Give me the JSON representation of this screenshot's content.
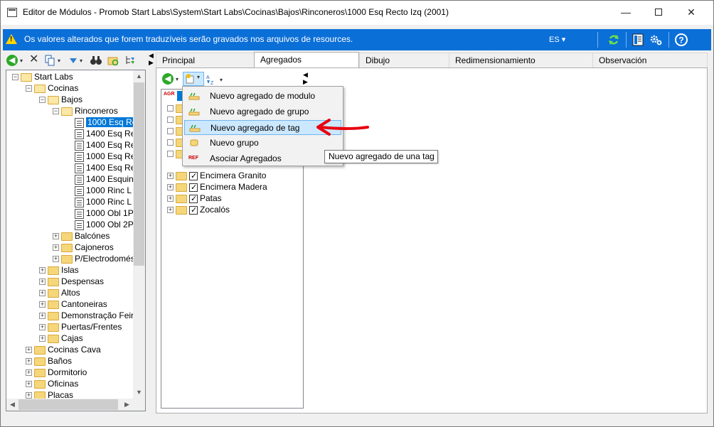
{
  "window": {
    "title": "Editor de Módulos - Promob Start Labs\\System\\Start Labs\\Cocinas\\Bajos\\Rinconeros\\1000 Esq Recto Izq (2001)",
    "minimize_label": "—",
    "close_label": "✕"
  },
  "infobar": {
    "message": "Os valores alterados que forem traduzíveis serão gravados nos arquivos de resources.",
    "warning_glyph": "!",
    "language": "ES ▾",
    "bg_color": "#0b6fd8"
  },
  "left_toolbar": {
    "back_glyph": "◀",
    "delete_glyph": "✕",
    "arrow_glyph": "▾"
  },
  "tree": {
    "items": [
      {
        "label": "Start Labs",
        "level": 0,
        "icon": "folder-open-icon",
        "exp": "−"
      },
      {
        "label": "Cocinas",
        "level": 1,
        "icon": "folder-open-icon",
        "exp": "−"
      },
      {
        "label": "Bajos",
        "level": 2,
        "icon": "folder-open-icon",
        "exp": "−"
      },
      {
        "label": "Rinconeros",
        "level": 3,
        "icon": "folder-open-icon",
        "exp": "−"
      },
      {
        "label": "1000 Esq Re",
        "level": 4,
        "icon": "doc-icon",
        "selected": true
      },
      {
        "label": "1400 Esq Re",
        "level": 4,
        "icon": "doc-icon"
      },
      {
        "label": "1400 Esq Re",
        "level": 4,
        "icon": "doc-icon"
      },
      {
        "label": "1000 Esq Re",
        "level": 4,
        "icon": "doc-icon"
      },
      {
        "label": "1400 Esq Re",
        "level": 4,
        "icon": "doc-icon"
      },
      {
        "label": "1400 Esquin",
        "level": 4,
        "icon": "doc-icon"
      },
      {
        "label": "1000 Rinc L",
        "level": 4,
        "icon": "doc-icon"
      },
      {
        "label": "1000 Rinc L",
        "level": 4,
        "icon": "doc-icon"
      },
      {
        "label": "1000 Obl 1P",
        "level": 4,
        "icon": "doc-icon"
      },
      {
        "label": "1000 Obl 2P",
        "level": 4,
        "icon": "doc-icon"
      },
      {
        "label": "Balcónes",
        "level": 3,
        "icon": "folder-icon",
        "exp": "+"
      },
      {
        "label": "Cajoneros",
        "level": 3,
        "icon": "folder-icon",
        "exp": "+"
      },
      {
        "label": "P/Electrodomést",
        "level": 3,
        "icon": "folder-icon",
        "exp": "+"
      },
      {
        "label": "Islas",
        "level": 2,
        "icon": "folder-icon",
        "exp": "+"
      },
      {
        "label": "Despensas",
        "level": 2,
        "icon": "folder-icon",
        "exp": "+"
      },
      {
        "label": "Altos",
        "level": 2,
        "icon": "folder-icon",
        "exp": "+"
      },
      {
        "label": "Cantoneiras",
        "level": 2,
        "icon": "folder-icon",
        "exp": "+"
      },
      {
        "label": "Demonstração Feira",
        "level": 2,
        "icon": "folder-icon",
        "exp": "+"
      },
      {
        "label": "Puertas/Frentes",
        "level": 2,
        "icon": "folder-icon",
        "exp": "+"
      },
      {
        "label": "Cajas",
        "level": 2,
        "icon": "folder-icon",
        "exp": "+"
      },
      {
        "label": "Cocinas Cava",
        "level": 1,
        "icon": "folder-icon",
        "exp": "+"
      },
      {
        "label": "Baños",
        "level": 1,
        "icon": "folder-icon",
        "exp": "+"
      },
      {
        "label": "Dormitorio",
        "level": 1,
        "icon": "folder-icon",
        "exp": "+"
      },
      {
        "label": "Oficinas",
        "level": 1,
        "icon": "folder-icon",
        "exp": "+"
      },
      {
        "label": "Placas",
        "level": 1,
        "icon": "folder-icon",
        "exp": "+"
      }
    ]
  },
  "tabs": [
    {
      "label": "Principal"
    },
    {
      "label": "Agregados",
      "active": true
    },
    {
      "label": "Dibujo"
    },
    {
      "label": "Redimensionamiento"
    },
    {
      "label": "Observación"
    }
  ],
  "agregados_tree": {
    "items": [
      {
        "label": "Encimera Granito"
      },
      {
        "label": "Encimera Madera"
      },
      {
        "label": "Patas"
      },
      {
        "label": "Zocalós"
      }
    ]
  },
  "menu": {
    "items": [
      {
        "label": "Nuevo agregado de modulo",
        "icon": "add-module-aggregate-icon"
      },
      {
        "label": "Nuevo agregado de grupo",
        "icon": "add-group-aggregate-icon"
      },
      {
        "label": "Nuevo agregado de tag",
        "icon": "add-tag-aggregate-icon",
        "highlighted": true
      },
      {
        "label": "Nuevo grupo",
        "icon": "new-group-icon"
      },
      {
        "label": "Asociar Agregados",
        "icon": "ref-icon",
        "icon_text": "REF"
      }
    ]
  },
  "tooltip": {
    "text": "Nuevo agregado de una tag"
  },
  "inner_toolbar": {
    "agr_text": "AGR"
  },
  "colors": {
    "selection": "#0078d7",
    "menu_highlight": "#cce8ff",
    "annotation_arrow": "#e8000e"
  }
}
